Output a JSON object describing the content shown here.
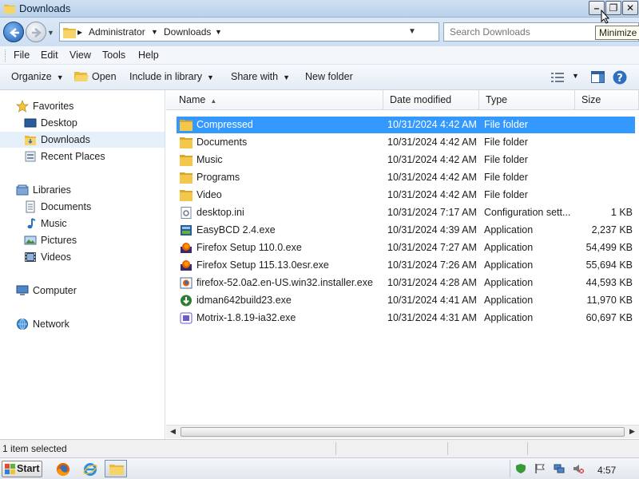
{
  "window": {
    "title": "Downloads",
    "tooltip": "Minimize",
    "buttons": {
      "minimize": "–",
      "restore": "❐",
      "close": "✕"
    }
  },
  "address": {
    "crumbs": [
      "Administrator",
      "Downloads"
    ],
    "search_placeholder": "Search Downloads"
  },
  "menu": [
    "File",
    "Edit",
    "View",
    "Tools",
    "Help"
  ],
  "commands": {
    "organize": "Organize",
    "open": "Open",
    "include_in_library": "Include in library",
    "share_with": "Share with",
    "new_folder": "New folder"
  },
  "nav": {
    "favorites": {
      "label": "Favorites",
      "items": [
        "Desktop",
        "Downloads",
        "Recent Places"
      ]
    },
    "libraries": {
      "label": "Libraries",
      "items": [
        "Documents",
        "Music",
        "Pictures",
        "Videos"
      ]
    },
    "computer": "Computer",
    "network": "Network"
  },
  "columns": {
    "name": "Name",
    "date": "Date modified",
    "type": "Type",
    "size": "Size"
  },
  "files": [
    {
      "name": "Compressed",
      "date": "10/31/2024 4:42 AM",
      "type": "File folder",
      "size": "",
      "icon": "folder-icon",
      "selected": true
    },
    {
      "name": "Documents",
      "date": "10/31/2024 4:42 AM",
      "type": "File folder",
      "size": "",
      "icon": "folder-icon"
    },
    {
      "name": "Music",
      "date": "10/31/2024 4:42 AM",
      "type": "File folder",
      "size": "",
      "icon": "folder-icon"
    },
    {
      "name": "Programs",
      "date": "10/31/2024 4:42 AM",
      "type": "File folder",
      "size": "",
      "icon": "folder-icon"
    },
    {
      "name": "Video",
      "date": "10/31/2024 4:42 AM",
      "type": "File folder",
      "size": "",
      "icon": "folder-icon"
    },
    {
      "name": "desktop.ini",
      "date": "10/31/2024 7:17 AM",
      "type": "Configuration sett...",
      "size": "1 KB",
      "icon": "ini-file-icon"
    },
    {
      "name": "EasyBCD 2.4.exe",
      "date": "10/31/2024 4:39 AM",
      "type": "Application",
      "size": "2,237 KB",
      "icon": "easybcd-icon"
    },
    {
      "name": "Firefox Setup 110.0.exe",
      "date": "10/31/2024 7:27 AM",
      "type": "Application",
      "size": "54,499 KB",
      "icon": "firefox-setup-icon"
    },
    {
      "name": "Firefox Setup 115.13.0esr.exe",
      "date": "10/31/2024 7:26 AM",
      "type": "Application",
      "size": "55,694 KB",
      "icon": "firefox-setup-icon"
    },
    {
      "name": "firefox-52.0a2.en-US.win32.installer.exe",
      "date": "10/31/2024 4:28 AM",
      "type": "Application",
      "size": "44,593 KB",
      "icon": "firefox-installer-icon"
    },
    {
      "name": "idman642build23.exe",
      "date": "10/31/2024 4:41 AM",
      "type": "Application",
      "size": "11,970 KB",
      "icon": "idm-icon"
    },
    {
      "name": "Motrix-1.8.19-ia32.exe",
      "date": "10/31/2024 4:31 AM",
      "type": "Application",
      "size": "60,697 KB",
      "icon": "motrix-icon"
    }
  ],
  "status": {
    "text": "1 item selected"
  },
  "taskbar": {
    "start": "Start",
    "clock": "4:57"
  },
  "colors": {
    "selection": "#3399ff",
    "titlebar": "#b9d1ea",
    "folder": "#f3c74a"
  }
}
